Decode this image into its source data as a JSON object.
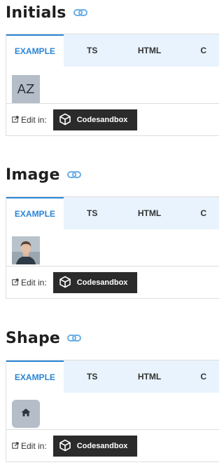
{
  "sections": [
    {
      "title": "Initials",
      "tabs": [
        "EXAMPLE",
        "TS",
        "HTML",
        "C"
      ],
      "avatar": {
        "kind": "initials",
        "text": "AZ"
      },
      "footer": {
        "edit_in": "Edit in:",
        "button": "Codesandbox"
      }
    },
    {
      "title": "Image",
      "tabs": [
        "EXAMPLE",
        "TS",
        "HTML",
        "C"
      ],
      "avatar": {
        "kind": "image",
        "alt": "user photo"
      },
      "footer": {
        "edit_in": "Edit in:",
        "button": "Codesandbox"
      }
    },
    {
      "title": "Shape",
      "tabs": [
        "EXAMPLE",
        "TS",
        "HTML",
        "C"
      ],
      "avatar": {
        "kind": "shape",
        "icon": "home-icon"
      },
      "footer": {
        "edit_in": "Edit in:",
        "button": "Codesandbox"
      }
    }
  ],
  "colors": {
    "accent": "#2b86d6",
    "tab_bg": "#e8f3fd",
    "avatar_bg": "#b4bdc8",
    "button_bg": "#2b2b2b",
    "link_icon": "#6aaee8"
  }
}
